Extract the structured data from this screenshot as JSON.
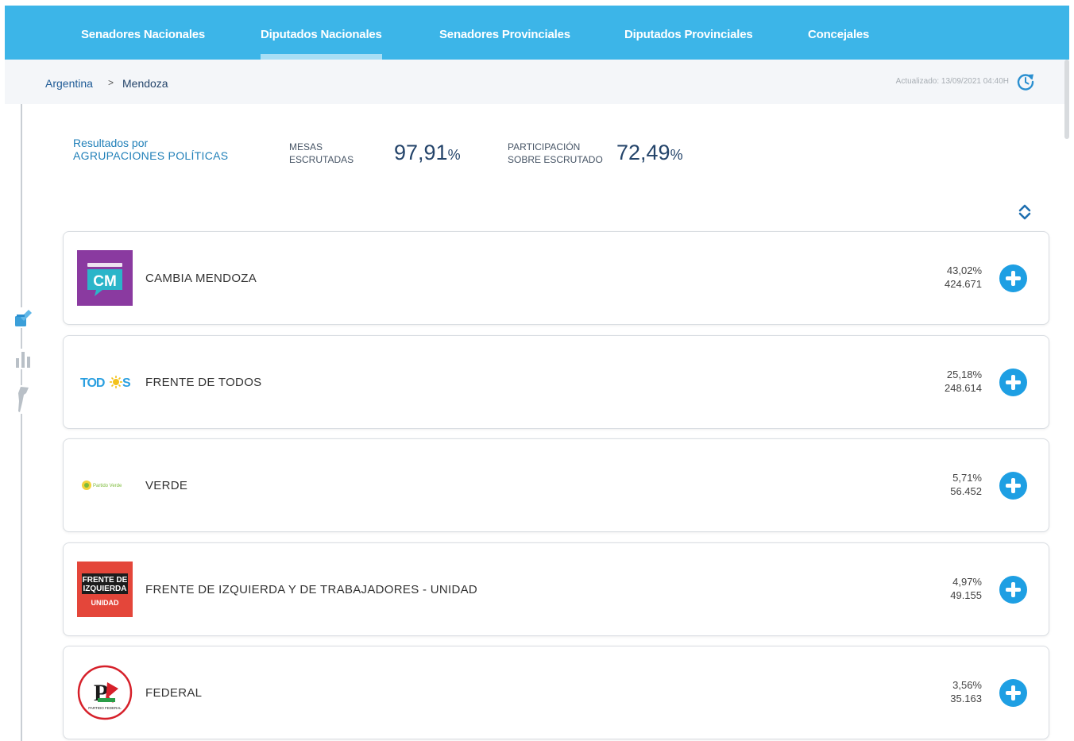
{
  "nav": {
    "tabs": [
      {
        "label": "Senadores Nacionales",
        "active": false
      },
      {
        "label": "Diputados Nacionales",
        "active": true
      },
      {
        "label": "Senadores Provinciales",
        "active": false
      },
      {
        "label": "Diputados Provinciales",
        "active": false
      },
      {
        "label": "Concejales",
        "active": false
      }
    ]
  },
  "breadcrumb": {
    "root": "Argentina",
    "separator": ">",
    "current": "Mendoza"
  },
  "updated": "Actualizado: 13/09/2021 04:40H",
  "summary": {
    "results_line1": "Resultados por",
    "results_line2": "AGRUPACIONES POLÍTICAS",
    "mesas_label_1": "MESAS",
    "mesas_label_2": "ESCRUTADAS",
    "mesas_value": "97,91",
    "participacion_label_1": "PARTICIPACIÓN",
    "participacion_label_2": "SOBRE ESCRUTADO",
    "participacion_value": "72,49",
    "percent_sign": "%"
  },
  "parties": [
    {
      "name": "CAMBIA MENDOZA",
      "percent": "43,02%",
      "votes": "424.671",
      "logo_text": "CM"
    },
    {
      "name": "FRENTE DE TODOS",
      "percent": "25,18%",
      "votes": "248.614",
      "logo_text_a": "TOD",
      "logo_text_b": "S"
    },
    {
      "name": "VERDE",
      "percent": "5,71%",
      "votes": "56.452",
      "logo_text": "Partido Verde"
    },
    {
      "name": "FRENTE DE IZQUIERDA Y DE TRABAJADORES - UNIDAD",
      "percent": "4,97%",
      "votes": "49.155",
      "logo_line1": "FRENTE DE",
      "logo_line2": "IZQUIERDA",
      "logo_line3": "UNIDAD"
    },
    {
      "name": "FEDERAL",
      "percent": "3,56%",
      "votes": "35.163",
      "logo_text": "P",
      "logo_sub": "PARTIDO FEDERAL"
    }
  ],
  "colors": {
    "nav_bg": "#3cb5e8",
    "accent_blue": "#1e9fe3",
    "title_navy": "#24446a",
    "cm_purple": "#8a3aa0",
    "cm_teal": "#2bb5c9",
    "fit_red": "#e4463a"
  }
}
